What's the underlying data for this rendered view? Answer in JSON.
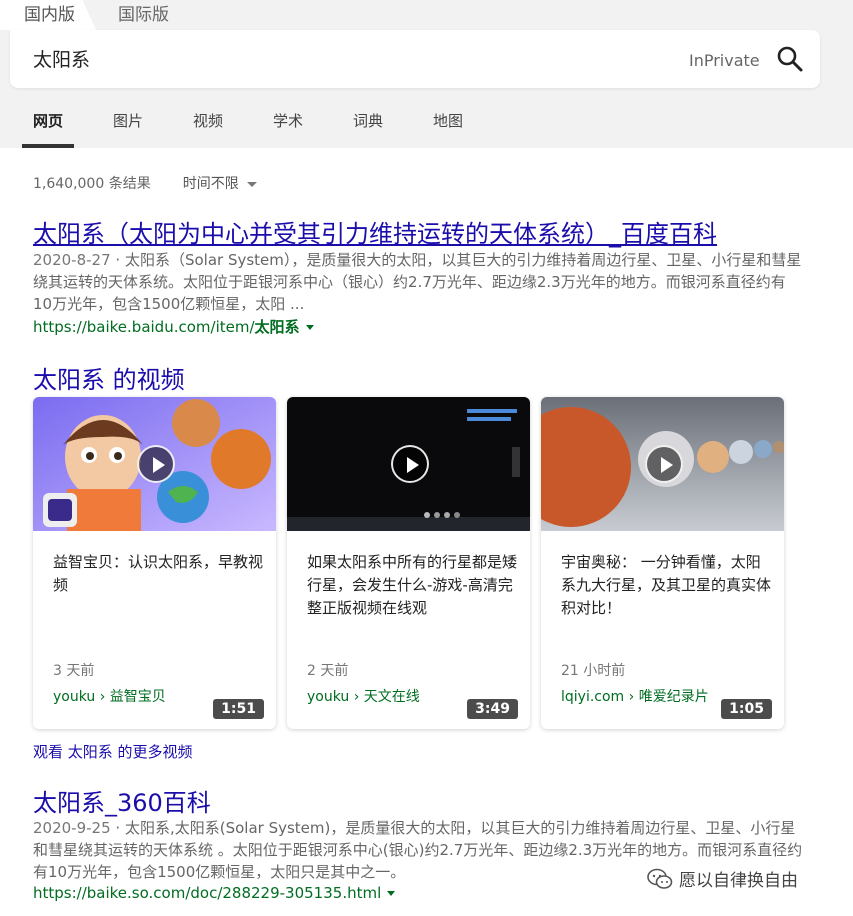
{
  "region_tabs": [
    "国内版",
    "国际版"
  ],
  "search": {
    "value": "太阳系",
    "inprivate": "InPrivate"
  },
  "nav": [
    "网页",
    "图片",
    "视频",
    "学术",
    "词典",
    "地图"
  ],
  "meta": {
    "count": "1,640,000 条结果",
    "time_filter": "时间不限"
  },
  "results": [
    {
      "title": "太阳系（太阳为中心并受其引力维持运转的天体系统）_百度百科",
      "date": "2020-8-27",
      "snippet": "太阳系（Solar System），是质量很大的太阳，以其巨大的引力维持着周边行星、卫星、小行星和彗星绕其运转的天体系统。太阳位于距银河系中心（银心）约2.7万光年、距边缘2.3万光年的地方。而银河系直径约有10万光年，包含1500亿颗恒星，太阳 ...",
      "url_prefix": "https://baike.baidu.com/item/",
      "url_bold": "太阳系"
    },
    {
      "title": "太阳系_360百科",
      "date": "2020-9-25",
      "snippet": "太阳系,太阳系(Solar System)，是质量很大的太阳，以其巨大的引力维持着周边行星、卫星、小行星和彗星绕其运转的天体系统 。太阳位于距银河系中心(银心)约2.7万光年、距边缘2.3万光年的地方。而银河系直径约有10万光年，包含1500亿颗恒星，太阳只是其中之一。",
      "url_prefix": "https://baike.so.com/doc/288229-305135.html",
      "url_bold": ""
    }
  ],
  "videos": {
    "heading": "太阳系 的视频",
    "items": [
      {
        "duration": "1:51",
        "title": "益智宝贝：认识太阳系，早教视频",
        "time": "3 天前",
        "source": "youku › 益智宝贝"
      },
      {
        "duration": "3:49",
        "title": "如果太阳系中所有的行星都是矮行星，会发生什么-游戏-高清完整正版视频在线观",
        "time": "2 天前",
        "source": "youku › 天文在线"
      },
      {
        "duration": "1:05",
        "title": "宇宙奥秘： 一分钟看懂，太阳系九大行星，及其卫星的真实体积对比！",
        "time": "21 小时前",
        "source": "lqiyi.com › 唯爱纪录片"
      }
    ],
    "more": "观看 太阳系 的更多视频"
  },
  "watermark": "愿以自律换自由",
  "colors": {
    "link": "#1a0dab",
    "url_green": "#006d21",
    "header_bg": "#f2f2f2"
  }
}
